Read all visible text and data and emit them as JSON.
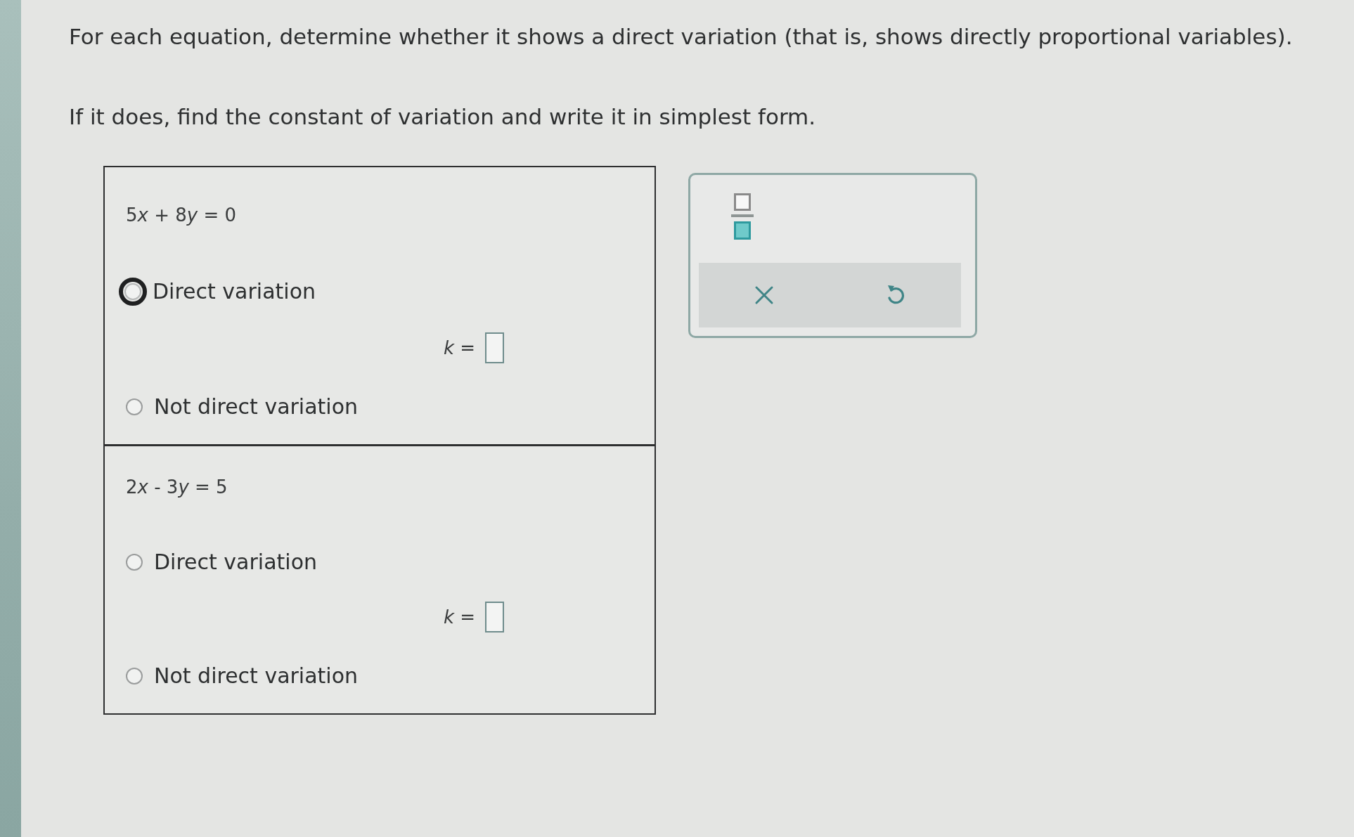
{
  "instructions": [
    "For each equation, determine whether it shows a direct variation (that is, shows directly proportional variables).",
    "If it does, find the constant of variation and write it in simplest form."
  ],
  "questions": [
    {
      "equation": "5x + 8y = 0",
      "options": [
        {
          "label": "Direct variation",
          "selected": false,
          "focused": true
        },
        {
          "label": "Not direct variation",
          "selected": false,
          "focused": false
        }
      ],
      "answer_label": "k ="
    },
    {
      "equation": "2x - 3y = 5",
      "options": [
        {
          "label": "Direct variation",
          "selected": false,
          "focused": false
        },
        {
          "label": "Not direct variation",
          "selected": false,
          "focused": false
        }
      ],
      "answer_label": "k ="
    }
  ],
  "palette": {
    "tools": [
      {
        "kind": "fraction"
      }
    ],
    "actions": [
      {
        "kind": "clear"
      },
      {
        "kind": "undo"
      }
    ]
  }
}
